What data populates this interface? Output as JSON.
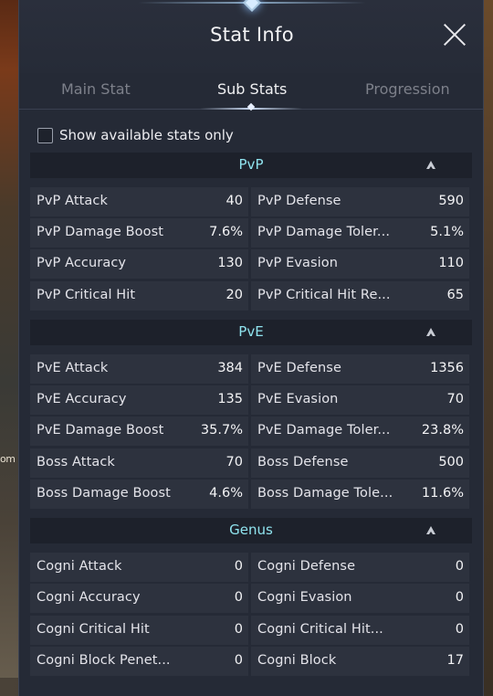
{
  "background": {
    "edge_text": "om"
  },
  "window": {
    "title": "Stat Info",
    "close_icon": "close-icon"
  },
  "tabs": [
    {
      "label": "Main Stat",
      "active": false
    },
    {
      "label": "Sub Stats",
      "active": true
    },
    {
      "label": "Progression",
      "active": false
    }
  ],
  "filter": {
    "label": "Show available stats only",
    "checked": false
  },
  "colors": {
    "panel_bg": "#252a36",
    "section_bg": "#1d212b",
    "cell_bg": "#2d323e",
    "section_title": "#8fe3ee",
    "text": "#e4e4ea"
  },
  "sections": [
    {
      "title": "PvP",
      "rows": [
        [
          {
            "name": "PvP Attack",
            "value": "40"
          },
          {
            "name": "PvP Defense",
            "value": "590"
          }
        ],
        [
          {
            "name": "PvP Damage Boost",
            "value": "7.6%"
          },
          {
            "name": "PvP Damage Toler...",
            "value": "5.1%"
          }
        ],
        [
          {
            "name": "PvP Accuracy",
            "value": "130"
          },
          {
            "name": "PvP Evasion",
            "value": "110"
          }
        ],
        [
          {
            "name": "PvP Critical Hit",
            "value": "20"
          },
          {
            "name": "PvP Critical Hit Re...",
            "value": "65"
          }
        ]
      ]
    },
    {
      "title": "PvE",
      "rows": [
        [
          {
            "name": "PvE Attack",
            "value": "384"
          },
          {
            "name": "PvE Defense",
            "value": "1356"
          }
        ],
        [
          {
            "name": "PvE Accuracy",
            "value": "135"
          },
          {
            "name": "PvE Evasion",
            "value": "70"
          }
        ],
        [
          {
            "name": "PvE Damage Boost",
            "value": "35.7%"
          },
          {
            "name": "PvE Damage Toler...",
            "value": "23.8%"
          }
        ],
        [
          {
            "name": "Boss Attack",
            "value": "70"
          },
          {
            "name": "Boss Defense",
            "value": "500"
          }
        ],
        [
          {
            "name": "Boss Damage Boost",
            "value": "4.6%"
          },
          {
            "name": "Boss Damage Tole...",
            "value": "11.6%"
          }
        ]
      ]
    },
    {
      "title": "Genus",
      "rows": [
        [
          {
            "name": "Cogni Attack",
            "value": "0"
          },
          {
            "name": "Cogni Defense",
            "value": "0"
          }
        ],
        [
          {
            "name": "Cogni Accuracy",
            "value": "0"
          },
          {
            "name": "Cogni Evasion",
            "value": "0"
          }
        ],
        [
          {
            "name": "Cogni Critical Hit",
            "value": "0"
          },
          {
            "name": "Cogni Critical Hit...",
            "value": "0"
          }
        ],
        [
          {
            "name": "Cogni Block Penet...",
            "value": "0"
          },
          {
            "name": "Cogni Block",
            "value": "17"
          }
        ]
      ]
    }
  ]
}
